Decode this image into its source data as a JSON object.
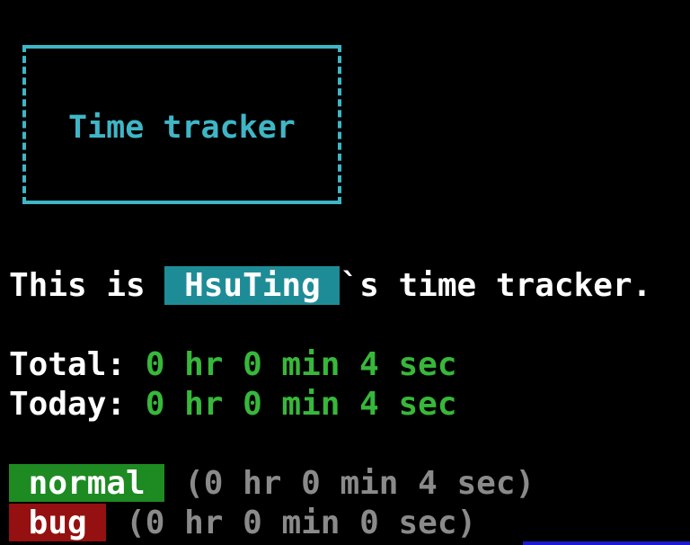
{
  "header_box": {
    "title": "Time tracker"
  },
  "owner_line": {
    "prefix": "This is ",
    "name": " HsuTing ",
    "suffix": "`s time tracker."
  },
  "summary": {
    "total_label": "Total: ",
    "total_value": "0 hr 0 min 4 sec",
    "today_label": "Today: ",
    "today_value": "0 hr 0 min 4 sec"
  },
  "tags": [
    {
      "label": " normal ",
      "duration": " (0 hr 0 min 4 sec)"
    },
    {
      "label": " bug ",
      "duration": " (0 hr 0 min 0 sec)"
    }
  ],
  "colors": {
    "accent_cyan": "#3fb6c6",
    "name_bg": "#1e8c96",
    "value_green": "#37b83a",
    "normal_tag_bg": "#1e8a22",
    "bug_tag_bg": "#951010",
    "duration_gray": "#8a8a8a",
    "background": "#000000"
  }
}
